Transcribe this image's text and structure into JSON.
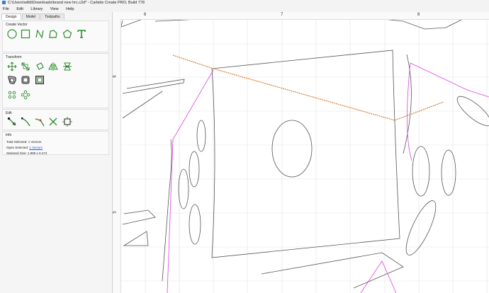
{
  "window": {
    "title": "C:\\Users\\willd\\Downloads\\brand new hrc.c2d* - Carbide Create PRO, Build 778"
  },
  "menu": [
    "File",
    "Edit",
    "Library",
    "View",
    "Help"
  ],
  "tabs": [
    "Design",
    "Model",
    "Toolpaths"
  ],
  "create_vector": {
    "title": "Create Vector",
    "tools": [
      "circle-icon",
      "rectangle-icon",
      "curve-icon",
      "polyline-icon",
      "polygon-icon",
      "text-icon"
    ]
  },
  "transform": {
    "title": "Transform",
    "tools": [
      "move-icon",
      "scale-icon",
      "rotate-icon",
      "flip-icon",
      "align-icon",
      "offset-icon",
      "boolean-icon",
      "group-icon",
      "array-icon",
      "circular-array-icon"
    ]
  },
  "edit": {
    "title": "Edit",
    "tools": [
      "node-edit-icon",
      "smooth-icon",
      "fillet-icon",
      "trim-icon",
      "bounding-box-icon"
    ]
  },
  "info": {
    "title": "Info",
    "total_selected_label": "Total Selected:",
    "total_selected_value": "1 Vectors",
    "open_selected_label": "Open Selected:",
    "open_selected_value": "1 Vectors",
    "selected_size_label": "Selected Size:",
    "selected_size_value": "1.980 x 0.474"
  },
  "rulers": {
    "horizontal": [
      "6",
      "7",
      "8"
    ],
    "vertical": [
      "6",
      "5"
    ]
  },
  "colors": {
    "accent": "#2e8b2e",
    "selection": "#e07a30",
    "guide": "#e040e0",
    "marker": "#e03030"
  }
}
